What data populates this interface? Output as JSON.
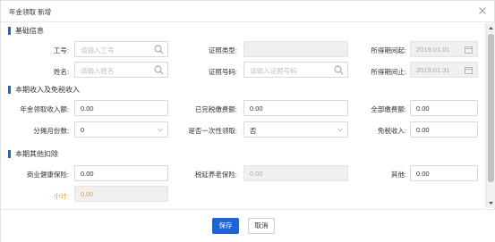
{
  "dialog": {
    "title": "年金领取 新增"
  },
  "sections": {
    "basic": "基础信息",
    "income": "本期收入及免税收入",
    "deduction": "本期其他扣除"
  },
  "basic": {
    "employee_no": {
      "label": "工号:",
      "placeholder": "请输入工号"
    },
    "cert_type": {
      "label": "证照类型:",
      "value": ""
    },
    "period_start": {
      "label": "所得期间起:",
      "value": "2019.01.01"
    },
    "name": {
      "label": "姓名:",
      "placeholder": "请输入姓名"
    },
    "cert_no": {
      "label": "证照号码:",
      "placeholder": "请输入证照号码"
    },
    "period_end": {
      "label": "所得期间止:",
      "value": "2019.01.31"
    }
  },
  "income": {
    "annuity_income": {
      "label": "年金领取收入额:",
      "value": "0.00"
    },
    "tax_paid_contrib": {
      "label": "已完税缴费额:",
      "value": "0.00"
    },
    "total_contrib": {
      "label": "全部缴费额:",
      "value": "0.00"
    },
    "installments": {
      "label": "分摊月份数:",
      "value": "0"
    },
    "lump_sum": {
      "label": "是否一次性领取:",
      "value": "否"
    },
    "tax_free_income": {
      "label": "免税收入:",
      "value": "0.00"
    }
  },
  "deduction": {
    "health_insurance": {
      "label": "商业健康保险:",
      "value": "0.00"
    },
    "tax_deferred_pension": {
      "label": "税延养老保险:",
      "value": "0.00"
    },
    "other": {
      "label": "其他:",
      "value": "0.00"
    },
    "subtotal": {
      "label": "小计:",
      "value": "0.00"
    }
  },
  "footer": {
    "save_label": "保存",
    "cancel_label": "取消"
  },
  "colors": {
    "accent": "#1c63d6",
    "subtotal": "#f0992b"
  },
  "icons": {
    "close": "close-icon",
    "search": "search-icon",
    "calendar": "calendar-icon",
    "dropdown": "chevron-down-icon"
  }
}
